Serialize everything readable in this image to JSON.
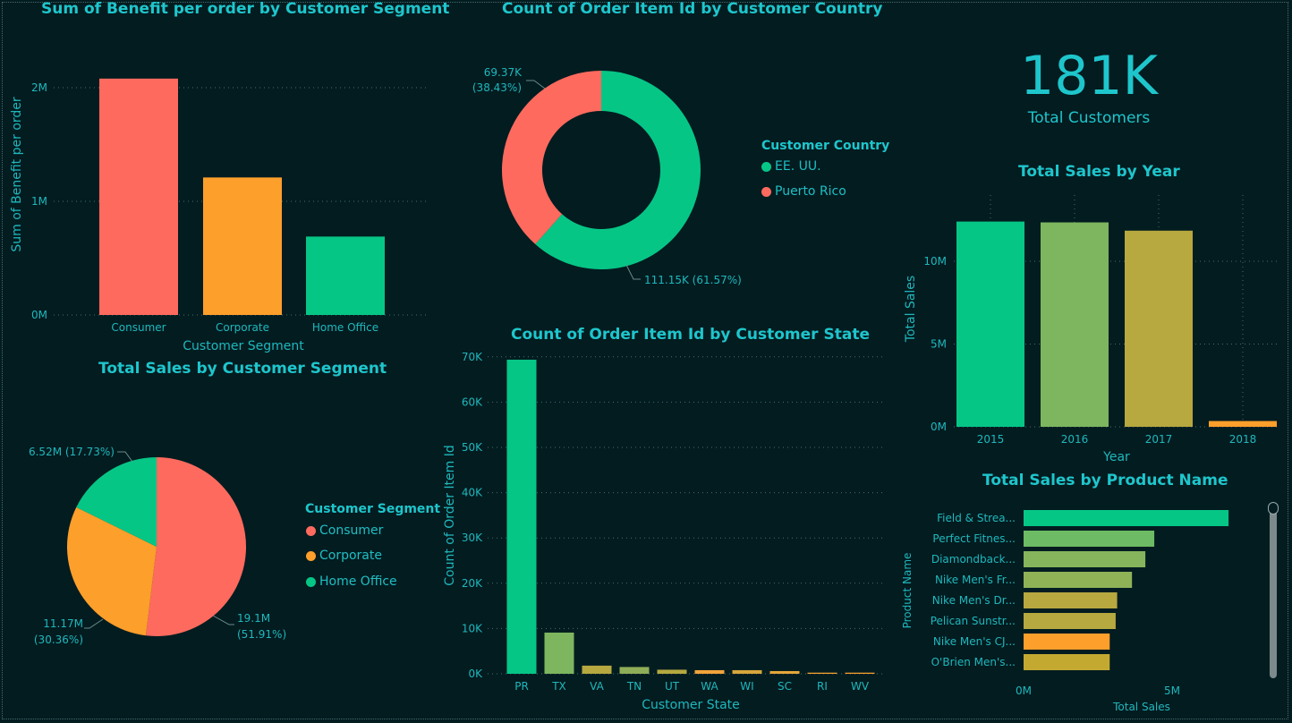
{
  "colors": {
    "red": "#fe6a5e",
    "orange": "#fd9f2b",
    "green": "#06c686",
    "green2": "#7db65e",
    "olive": "#b7a83f",
    "olive2": "#c4a931",
    "teal": "#1ec6cc"
  },
  "kpi": {
    "value": "181K",
    "label": "Total Customers"
  },
  "benefit_chart": {
    "title": "Sum of Benefit per order by Customer Segment",
    "ylabel": "Sum of Benefit per order",
    "xlabel": "Customer Segment",
    "yticks": [
      "0M",
      "1M",
      "2M"
    ]
  },
  "country_chart": {
    "title": "Count of Order Item Id by Customer Country",
    "legend_title": "Customer Country",
    "labels": [
      "111.15K (61.57%)",
      "69.37K",
      "(38.43%)"
    ]
  },
  "segment_pie": {
    "title": "Total Sales by Customer Segment",
    "legend_title": "Customer Segment",
    "labels": [
      "19.1M",
      "(51.91%)",
      "11.17M",
      "(30.36%)",
      "6.52M (17.73%)"
    ]
  },
  "state_chart": {
    "title": "Count of Order Item Id by Customer State",
    "ylabel": "Count of Order Item Id",
    "xlabel": "Customer State",
    "yticks": [
      "0K",
      "10K",
      "20K",
      "30K",
      "40K",
      "50K",
      "60K",
      "70K"
    ]
  },
  "year_chart": {
    "title": "Total Sales by Year",
    "ylabel": "Total Sales",
    "xlabel": "Year",
    "yticks": [
      "0M",
      "5M",
      "10M"
    ]
  },
  "product_chart": {
    "title": "Total Sales by Product Name",
    "ylabel": "Product Name",
    "xlabel": "Total Sales",
    "xticks": [
      "0M",
      "5M"
    ]
  },
  "chart_data": [
    {
      "type": "bar",
      "title": "Sum of Benefit per order by Customer Segment",
      "xlabel": "Customer Segment",
      "ylabel": "Sum of Benefit per order",
      "categories": [
        "Consumer",
        "Corporate",
        "Home Office"
      ],
      "values": [
        2080000,
        1210000,
        690000
      ],
      "colors": [
        "#fe6a5e",
        "#fd9f2b",
        "#06c686"
      ],
      "ylim": [
        0,
        2000000
      ],
      "grid": true
    },
    {
      "type": "pie",
      "title": "Count of Order Item Id by Customer Country",
      "categories": [
        "EE. UU.",
        "Puerto Rico"
      ],
      "values": [
        111150,
        69370
      ],
      "percent": [
        61.57,
        38.43
      ],
      "colors": [
        "#06c686",
        "#fe6a5e"
      ],
      "legend": "right"
    },
    {
      "type": "pie",
      "title": "Total Sales by Customer Segment",
      "categories": [
        "Consumer",
        "Corporate",
        "Home Office"
      ],
      "values": [
        19100000,
        11170000,
        6520000
      ],
      "percent": [
        51.91,
        30.36,
        17.73
      ],
      "colors": [
        "#fe6a5e",
        "#fd9f2b",
        "#06c686"
      ],
      "legend": "right"
    },
    {
      "type": "bar",
      "title": "Count of Order Item Id by Customer State",
      "xlabel": "Customer State",
      "ylabel": "Count of Order Item Id",
      "categories": [
        "PR",
        "TX",
        "VA",
        "TN",
        "UT",
        "WA",
        "WI",
        "SC",
        "RI",
        "WV"
      ],
      "values": [
        69370,
        9100,
        1800,
        1500,
        900,
        800,
        800,
        600,
        250,
        250
      ],
      "colors": [
        "#06c686",
        "#7db65e",
        "#b7a83f",
        "#8fae58",
        "#b5a93f",
        "#f2a33a",
        "#d6a63b",
        "#e5a63a",
        "#f6a230",
        "#f8a02d"
      ],
      "ylim": [
        0,
        70000
      ],
      "grid": true
    },
    {
      "type": "bar",
      "title": "Total Sales by Year",
      "xlabel": "Year",
      "ylabel": "Total Sales",
      "categories": [
        "2015",
        "2016",
        "2017",
        "2018"
      ],
      "values": [
        12400000,
        12350000,
        11850000,
        350000
      ],
      "colors": [
        "#06c686",
        "#7db65e",
        "#b7a83f",
        "#fd9f2b"
      ],
      "ylim": [
        0,
        10000000
      ],
      "grid": true
    },
    {
      "type": "bar",
      "orientation": "horizontal",
      "title": "Total Sales by Product Name",
      "xlabel": "Total Sales",
      "ylabel": "Product Name",
      "categories": [
        "Field & Strea...",
        "Perfect Fitnes...",
        "Diamondback...",
        "Nike Men's Fr...",
        "Nike Men's Dr...",
        "Pelican Sunstr...",
        "Nike Men's CJ...",
        "O'Brien Men's..."
      ],
      "values": [
        6900000,
        4400000,
        4100000,
        3650000,
        3150000,
        3100000,
        2900000,
        2900000
      ],
      "colors": [
        "#06c686",
        "#6dbb64",
        "#86b45c",
        "#8fb257",
        "#b7a83f",
        "#b5a93f",
        "#fd9f2b",
        "#c4a931"
      ],
      "xlim": [
        0,
        5000000
      ]
    }
  ]
}
